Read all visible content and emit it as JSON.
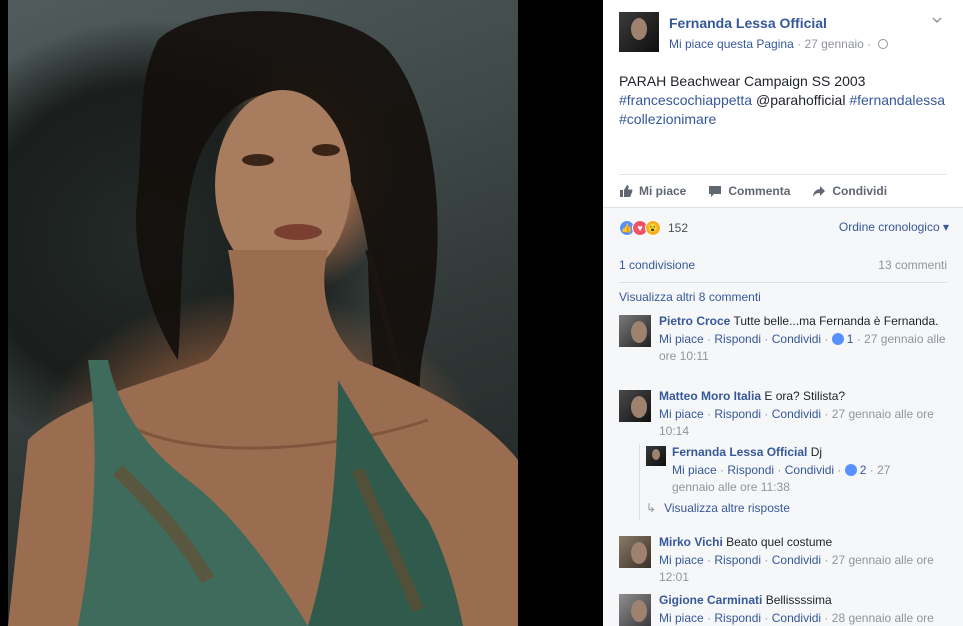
{
  "post": {
    "author": "Fernanda Lessa Official",
    "like_page": "Mi piace questa Pagina",
    "dot": "·",
    "date": "27 gennaio",
    "text": "PARAH Beachwear Campaign SS 2003",
    "hashtag_1": "#francescochiappetta",
    "mention": "@parahofficial",
    "hashtag_2": "#fernandalessa",
    "hashtag_3": "#collezionimare"
  },
  "actions": {
    "like": "Mi piace",
    "comment": "Commenta",
    "share": "Condividi"
  },
  "stats": {
    "reactions_count": "152",
    "order": "Ordine cronologico",
    "shares": "1 condivisione",
    "comments": "13 commenti",
    "more_comments": "Visualizza altri 8 commenti"
  },
  "comment_links": {
    "like": "Mi piace",
    "reply": "Rispondi",
    "share": "Condividi"
  },
  "comments": [
    {
      "name": "Pietro Croce",
      "text": "Tutte belle...ma Fernanda è Fernanda.",
      "likes": "1",
      "time": "27 gennaio alle ore 10:11"
    },
    {
      "name": "Matteo Moro Italia",
      "text": "E ora? Stilista?",
      "time": "27 gennaio alle ore 10:14"
    },
    {
      "name": "Mirko Vichi",
      "text": "Beato quel costume",
      "time": "27 gennaio alle ore 12:01"
    },
    {
      "name": "Gigione Carminati",
      "text": "Bellissssima",
      "time": "28 gennaio alle ore"
    }
  ],
  "reply": {
    "name": "Fernanda Lessa Official",
    "text": "Dj",
    "likes": "2",
    "time": "27 gennaio alle ore 11:38",
    "more_replies": "Visualizza altre risposte"
  },
  "colors": {
    "link": "#365899",
    "muted": "#90949c",
    "like_blue": "#5890ff",
    "love_red": "#f25268",
    "wow_yellow": "#f7b125"
  }
}
